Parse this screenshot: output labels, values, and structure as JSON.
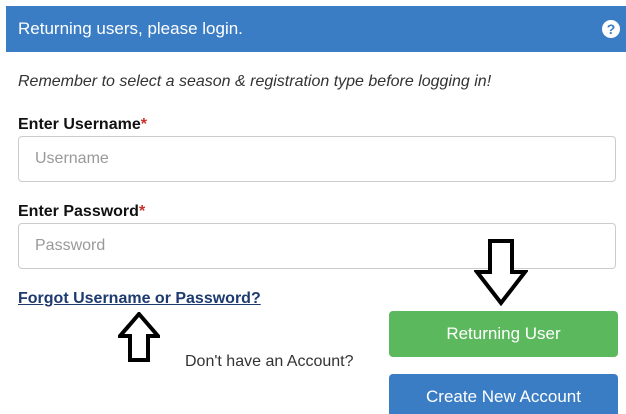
{
  "header": {
    "title": "Returning users, please login.",
    "help_icon": "question-circle-icon"
  },
  "note": "Remember to select a season & registration type before logging in!",
  "username": {
    "label": "Enter Username",
    "required_mark": "*",
    "placeholder": "Username",
    "value": ""
  },
  "password": {
    "label": "Enter Password",
    "required_mark": "*",
    "placeholder": "Password",
    "value": ""
  },
  "forgot_link": "Forgot Username or Password?",
  "no_account_text": "Don't have an Account?",
  "buttons": {
    "returning_user": "Returning User",
    "create_account": "Create New Account"
  },
  "colors": {
    "header_bg": "#3b7dc4",
    "returning_button": "#5cb85c",
    "create_button": "#3b7dc4",
    "required_mark": "#c9302c",
    "link": "#1e3a6e"
  }
}
